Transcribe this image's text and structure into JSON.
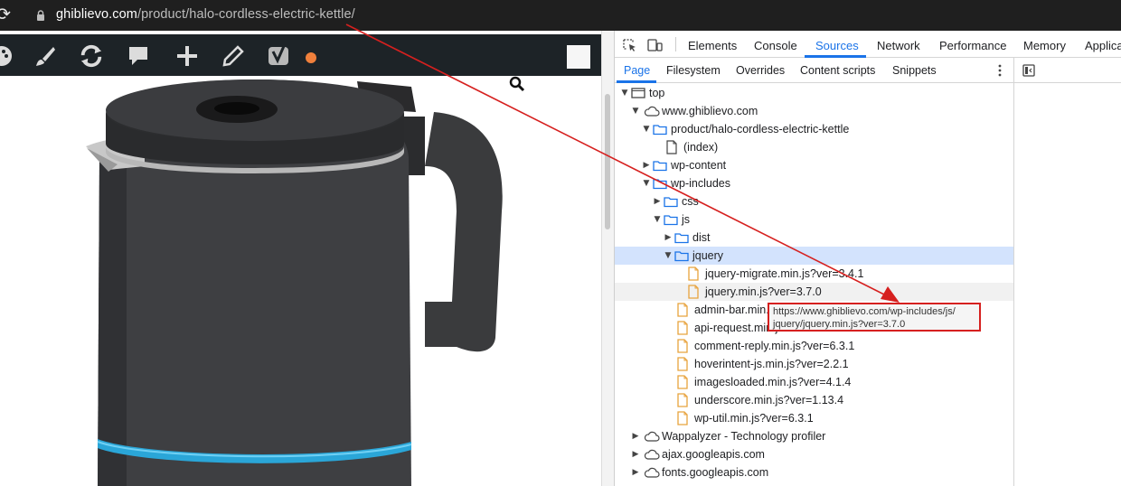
{
  "browser": {
    "url_host": "ghiblievo.com",
    "url_path": "/product/halo-cordless-electric-kettle/"
  },
  "devtools": {
    "tabs": [
      "Elements",
      "Console",
      "Sources",
      "Network",
      "Performance",
      "Memory",
      "Applica"
    ],
    "active_tab": "Sources",
    "subtabs": [
      "Page",
      "Filesystem",
      "Overrides",
      "Content scripts",
      "Snippets"
    ],
    "active_subtab": "Page",
    "tree": [
      {
        "label": "top",
        "depth": 0,
        "type": "frame",
        "expanded": true
      },
      {
        "label": "www.ghiblievo.com",
        "depth": 1,
        "type": "cloud",
        "expanded": true
      },
      {
        "label": "product/halo-cordless-electric-kettle",
        "depth": 2,
        "type": "folder",
        "expanded": true
      },
      {
        "label": "(index)",
        "depth": 3,
        "type": "doc"
      },
      {
        "label": "wp-content",
        "depth": 2,
        "type": "folder",
        "expanded": false
      },
      {
        "label": "wp-includes",
        "depth": 2,
        "type": "folder",
        "expanded": true
      },
      {
        "label": "css",
        "depth": 3,
        "type": "folder",
        "expanded": false
      },
      {
        "label": "js",
        "depth": 3,
        "type": "folder",
        "expanded": true
      },
      {
        "label": "dist",
        "depth": 4,
        "type": "folder",
        "expanded": false
      },
      {
        "label": "jquery",
        "depth": 4,
        "type": "folder",
        "expanded": true,
        "state": "selected"
      },
      {
        "label": "jquery-migrate.min.js?ver=3.4.1",
        "depth": 5,
        "type": "js"
      },
      {
        "label": "jquery.min.js?ver=3.7.0",
        "depth": 5,
        "type": "js",
        "state": "hover"
      },
      {
        "label": "admin-bar.min.js",
        "depth": 4,
        "type": "js"
      },
      {
        "label": "api-request.min.js",
        "depth": 4,
        "type": "js"
      },
      {
        "label": "comment-reply.min.js?ver=6.3.1",
        "depth": 4,
        "type": "js"
      },
      {
        "label": "hoverintent-js.min.js?ver=2.2.1",
        "depth": 4,
        "type": "js"
      },
      {
        "label": "imagesloaded.min.js?ver=4.1.4",
        "depth": 4,
        "type": "js"
      },
      {
        "label": "underscore.min.js?ver=1.13.4",
        "depth": 4,
        "type": "js"
      },
      {
        "label": "wp-util.min.js?ver=6.3.1",
        "depth": 4,
        "type": "js"
      },
      {
        "label": "Wappalyzer - Technology profiler",
        "depth": 1,
        "type": "cloud",
        "expanded": false
      },
      {
        "label": "ajax.googleapis.com",
        "depth": 1,
        "type": "cloud",
        "expanded": false
      },
      {
        "label": "fonts.googleapis.com",
        "depth": 1,
        "type": "cloud",
        "expanded": false
      }
    ],
    "tooltip": {
      "line1": "https://www.ghiblievo.com/wp-includes/js/",
      "line2": "jquery/jquery.min.js?ver=3.7.0"
    }
  },
  "colors": {
    "accent": "#1a73e8",
    "selected_row": "#d3e3fd",
    "js_icon": "#e8a33d",
    "folder_icon": "#1a73e8",
    "annotation": "#d6201f",
    "kettle_ring": "#2aa6d8"
  },
  "icons": [
    "reload-icon",
    "lock-icon",
    "palette-icon",
    "brush-icon",
    "refresh-icon",
    "comment-icon",
    "plus-icon",
    "pencil-icon",
    "yoast-icon",
    "search-icon",
    "inspect-icon",
    "device-icon",
    "kebab-icon",
    "pane-toggle-icon"
  ]
}
